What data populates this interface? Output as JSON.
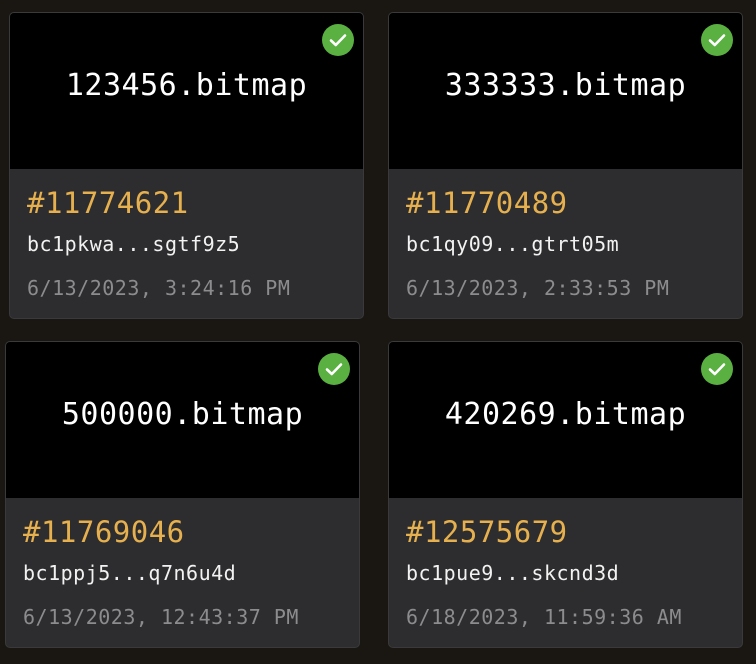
{
  "accent_colors": {
    "inscription_number": "#e6b04e",
    "check_badge": "#5ab040",
    "timestamp": "#8c8c8e"
  },
  "cards": [
    {
      "preview_text": "123456.bitmap",
      "inscription_number": "#11774621",
      "address": "bc1pkwa...sgtf9z5",
      "timestamp": "6/13/2023, 3:24:16 PM",
      "selected_icon": "check-circle-icon"
    },
    {
      "preview_text": "333333.bitmap",
      "inscription_number": "#11770489",
      "address": "bc1qy09...gtrt05m",
      "timestamp": "6/13/2023, 2:33:53 PM",
      "selected_icon": "check-circle-icon"
    },
    {
      "preview_text": "500000.bitmap",
      "inscription_number": "#11769046",
      "address": "bc1ppj5...q7n6u4d",
      "timestamp": "6/13/2023, 12:43:37 PM",
      "selected_icon": "check-circle-icon"
    },
    {
      "preview_text": "420269.bitmap",
      "inscription_number": "#12575679",
      "address": "bc1pue9...skcnd3d",
      "timestamp": "6/18/2023, 11:59:36 AM",
      "selected_icon": "check-circle-icon"
    }
  ]
}
